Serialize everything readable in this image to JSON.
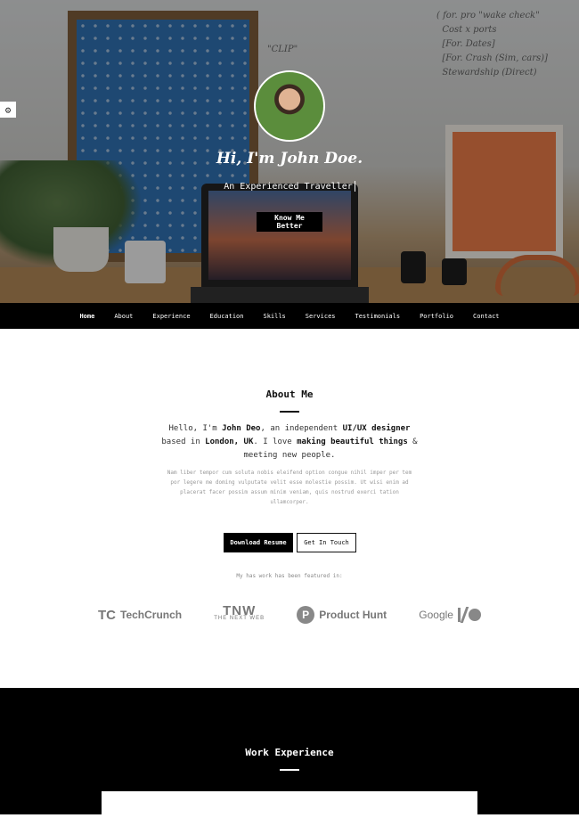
{
  "hero": {
    "name": "Hi, I'm John Doe.",
    "subtitle": "An Experienced Traveller",
    "cta": "Know Me Better"
  },
  "nav": {
    "items": [
      "Home",
      "About",
      "Experience",
      "Education",
      "Skills",
      "Services",
      "Testimonials",
      "Portfolio",
      "Contact"
    ],
    "active": "Home"
  },
  "about": {
    "title": "About Me",
    "lead_1": "Hello, I'm ",
    "lead_name": "John Deo",
    "lead_2": ", an independent ",
    "lead_role": "UI/UX designer",
    "lead_3": " based in ",
    "lead_city": "London, UK",
    "lead_4": ". I love ",
    "lead_passion": "making beautiful things",
    "lead_5": " & meeting new people.",
    "body": "Nam liber tempor cum soluta nobis eleifend option congue nihil imper per tem por legere me doming vulputate velit esse molestie possim. Ut wisi enim ad placerat facer possim assum minim veniam, quis nostrud exerci tation ullamcorper.",
    "download_button": "Download Resume",
    "contact_button": "Get In Touch",
    "featured_caption": "My has work has been featured in:"
  },
  "featured": {
    "techcrunch_mark": "TC",
    "techcrunch": "TechCrunch",
    "tnw_big": "TNW",
    "tnw_small": "THE NEXT WEB",
    "ph_mark": "P",
    "producthunt": "Product Hunt",
    "google": "Google"
  },
  "work": {
    "title": "Work Experience"
  },
  "colors": {
    "nav_bg": "#000000",
    "accent": "#111111"
  }
}
